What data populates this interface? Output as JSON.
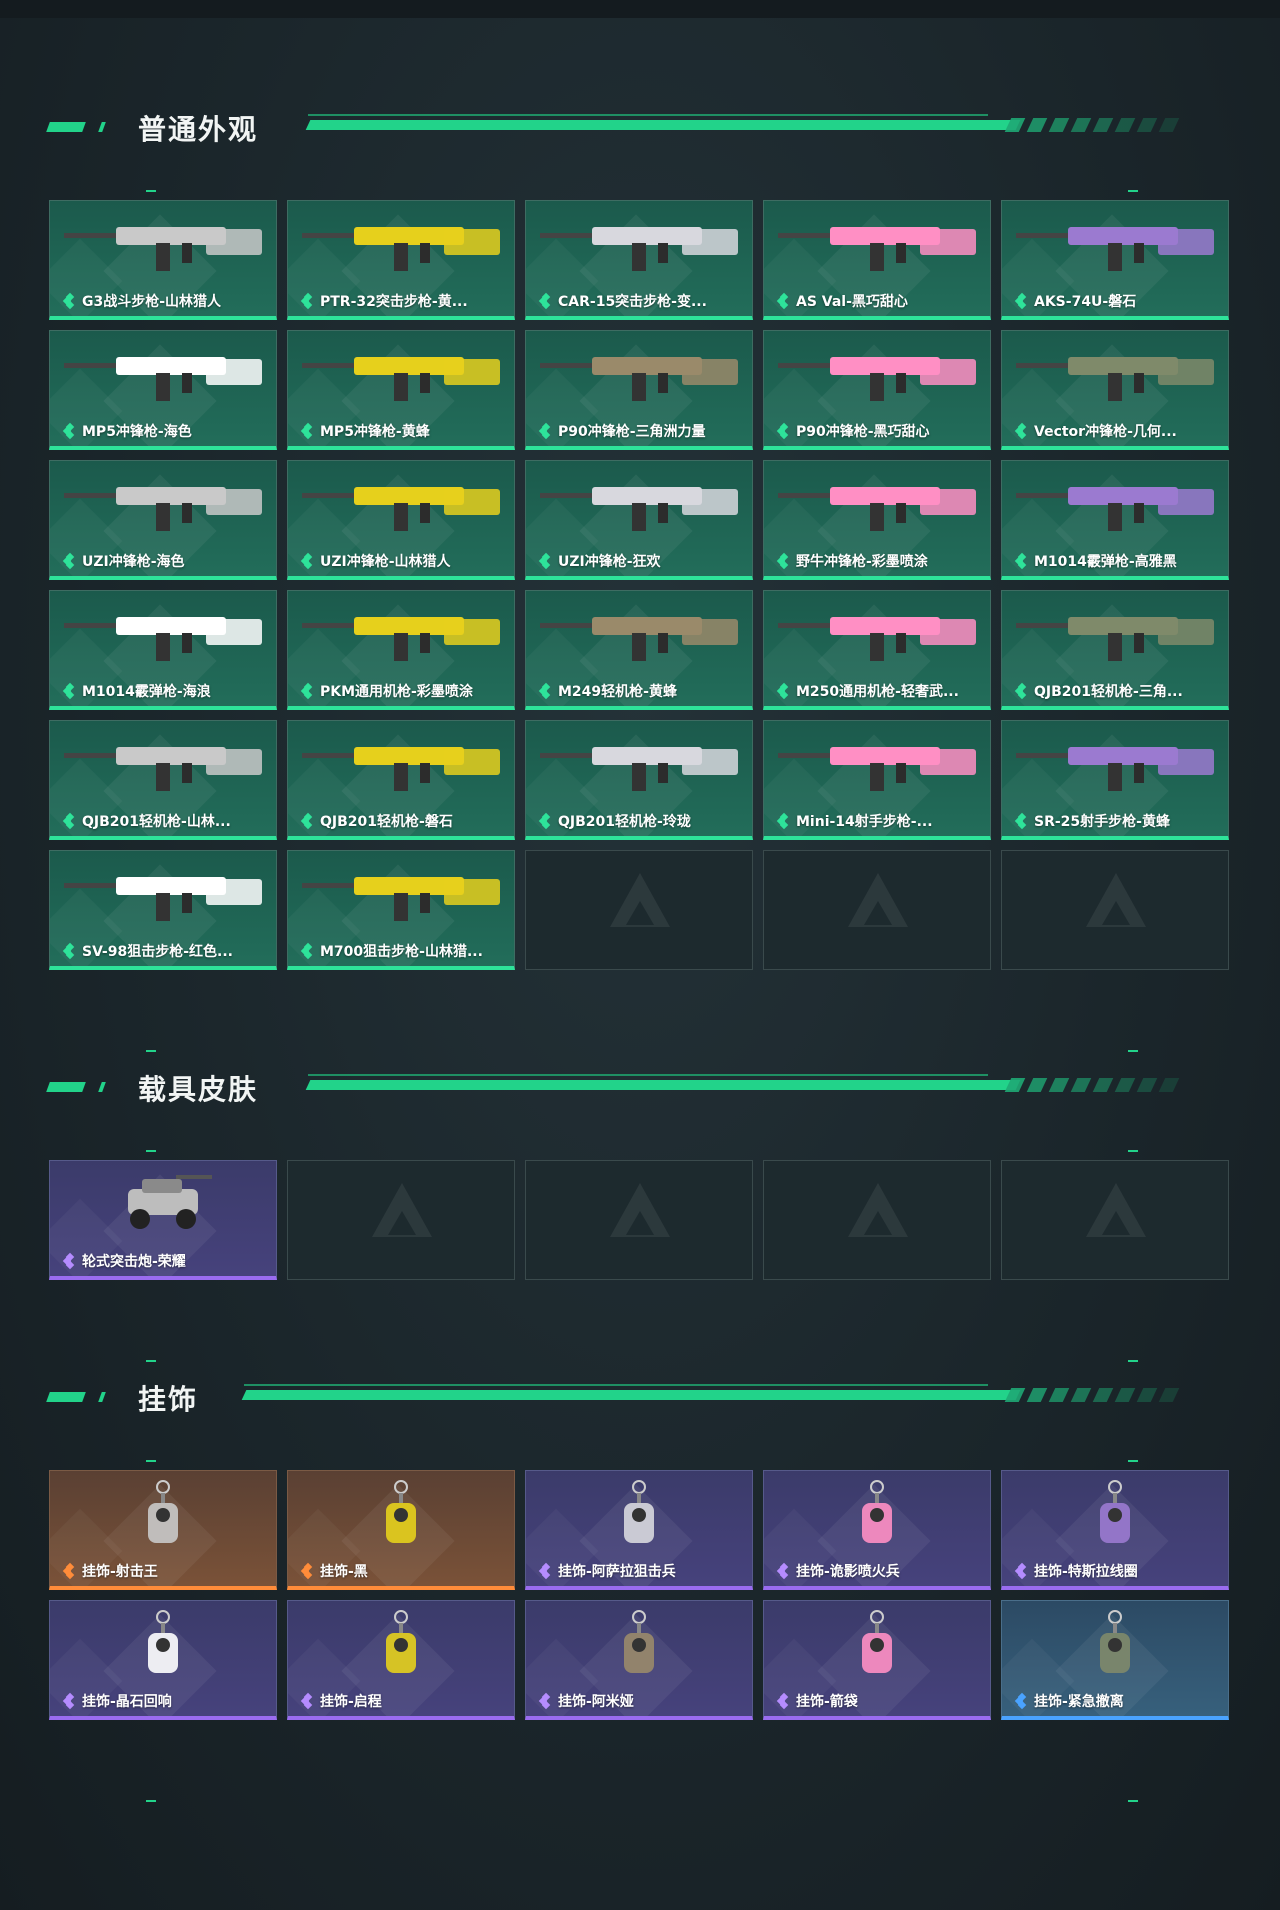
{
  "sections": [
    {
      "title": "普通外观",
      "items": [
        {
          "name": "G3战斗步枪-山林猎人",
          "rarity": "green",
          "icon": "rifle-icon"
        },
        {
          "name": "PTR-32突击步枪-黄...",
          "rarity": "green",
          "icon": "rifle-icon"
        },
        {
          "name": "CAR-15突击步枪-变...",
          "rarity": "green",
          "icon": "rifle-icon"
        },
        {
          "name": "AS Val-黑巧甜心",
          "rarity": "green",
          "icon": "rifle-icon"
        },
        {
          "name": "AKS-74U-磐石",
          "rarity": "green",
          "icon": "rifle-icon"
        },
        {
          "name": "MP5冲锋枪-海色",
          "rarity": "green",
          "icon": "smg-icon"
        },
        {
          "name": "MP5冲锋枪-黄蜂",
          "rarity": "green",
          "icon": "smg-icon"
        },
        {
          "name": "P90冲锋枪-三角洲力量",
          "rarity": "green",
          "icon": "smg-icon"
        },
        {
          "name": "P90冲锋枪-黑巧甜心",
          "rarity": "green",
          "icon": "smg-icon"
        },
        {
          "name": "Vector冲锋枪-几何...",
          "rarity": "green",
          "icon": "smg-icon"
        },
        {
          "name": "UZI冲锋枪-海色",
          "rarity": "green",
          "icon": "smg-icon"
        },
        {
          "name": "UZI冲锋枪-山林猎人",
          "rarity": "green",
          "icon": "smg-icon"
        },
        {
          "name": "UZI冲锋枪-狂欢",
          "rarity": "green",
          "icon": "smg-icon"
        },
        {
          "name": "野牛冲锋枪-彩墨喷涂",
          "rarity": "green",
          "icon": "smg-icon"
        },
        {
          "name": "M1014霰弹枪-高雅黑",
          "rarity": "green",
          "icon": "shotgun-icon"
        },
        {
          "name": "M1014霰弹枪-海浪",
          "rarity": "green",
          "icon": "shotgun-icon"
        },
        {
          "name": "PKM通用机枪-彩墨喷涂",
          "rarity": "green",
          "icon": "machine-gun-icon"
        },
        {
          "name": "M249轻机枪-黄蜂",
          "rarity": "green",
          "icon": "machine-gun-icon"
        },
        {
          "name": "M250通用机枪-轻奢武...",
          "rarity": "green",
          "icon": "machine-gun-icon"
        },
        {
          "name": "QJB201轻机枪-三角...",
          "rarity": "green",
          "icon": "machine-gun-icon"
        },
        {
          "name": "QJB201轻机枪-山林...",
          "rarity": "green",
          "icon": "machine-gun-icon"
        },
        {
          "name": "QJB201轻机枪-磐石",
          "rarity": "green",
          "icon": "machine-gun-icon"
        },
        {
          "name": "QJB201轻机枪-玲珑",
          "rarity": "green",
          "icon": "machine-gun-icon"
        },
        {
          "name": "Mini-14射手步枪-...",
          "rarity": "green",
          "icon": "rifle-icon"
        },
        {
          "name": "SR-25射手步枪-黄蜂",
          "rarity": "green",
          "icon": "rifle-icon"
        },
        {
          "name": "SV-98狙击步枪-红色...",
          "rarity": "green",
          "icon": "sniper-icon"
        },
        {
          "name": "M700狙击步枪-山林猎...",
          "rarity": "green",
          "icon": "sniper-icon"
        }
      ],
      "empty_slots": 3
    },
    {
      "title": "载具皮肤",
      "items": [
        {
          "name": "轮式突击炮-荣耀",
          "rarity": "purple",
          "icon": "vehicle-icon"
        }
      ],
      "empty_slots": 4
    },
    {
      "title": "挂饰",
      "items": [
        {
          "name": "挂饰-射击王",
          "rarity": "orange",
          "icon": "charm-icon"
        },
        {
          "name": "挂饰-黑",
          "rarity": "orange",
          "icon": "charm-icon"
        },
        {
          "name": "挂饰-阿萨拉狙击兵",
          "rarity": "purple",
          "icon": "charm-icon"
        },
        {
          "name": "挂饰-诡影喷火兵",
          "rarity": "purple",
          "icon": "charm-icon"
        },
        {
          "name": "挂饰-特斯拉线圈",
          "rarity": "purple",
          "icon": "charm-icon"
        },
        {
          "name": "挂饰-晶石回响",
          "rarity": "purple",
          "icon": "charm-icon"
        },
        {
          "name": "挂饰-启程",
          "rarity": "purple",
          "icon": "charm-icon"
        },
        {
          "name": "挂饰-阿米娅",
          "rarity": "purple",
          "icon": "charm-icon"
        },
        {
          "name": "挂饰-箭袋",
          "rarity": "purple",
          "icon": "charm-icon"
        },
        {
          "name": "挂饰-紧急撤离",
          "rarity": "blue",
          "icon": "charm-icon"
        }
      ],
      "empty_slots": 0
    }
  ],
  "colors": {
    "accent": "#22d38a",
    "green": "#2ee39a",
    "purple": "#9a6cf0",
    "orange": "#ff8c3a",
    "blue": "#4aa3ff"
  }
}
